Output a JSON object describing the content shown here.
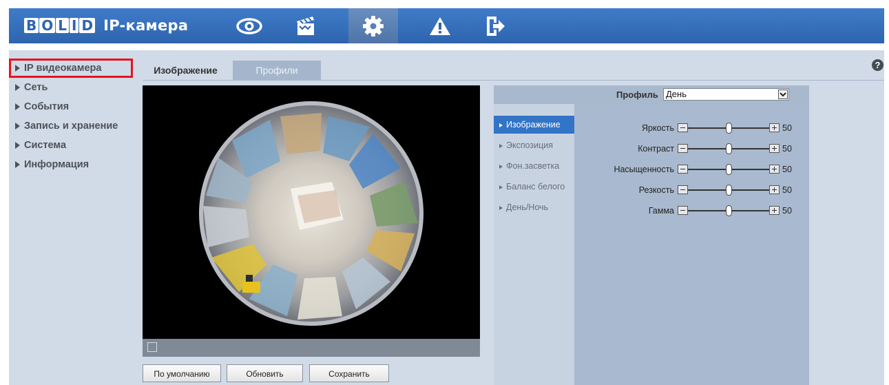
{
  "header": {
    "logo_letters": [
      "B",
      "O",
      "L",
      "I",
      "D"
    ],
    "logo_brand": "BOLID",
    "title": "IP-камера",
    "nav": [
      {
        "icon": "eye-icon"
      },
      {
        "icon": "clapperboard-icon"
      },
      {
        "icon": "gear-icon",
        "active": true
      },
      {
        "icon": "warning-icon"
      },
      {
        "icon": "exit-icon"
      }
    ]
  },
  "sidebar": {
    "items": [
      {
        "label": "IP видеокамера",
        "selected": true
      },
      {
        "label": "Сеть"
      },
      {
        "label": "События"
      },
      {
        "label": "Запись и хранение"
      },
      {
        "label": "Система"
      },
      {
        "label": "Информация"
      }
    ]
  },
  "tabs": [
    {
      "label": "Изображение",
      "active": true
    },
    {
      "label": "Профили",
      "active": false
    }
  ],
  "help_label": "?",
  "profile": {
    "label": "Профиль",
    "value": "День"
  },
  "subnav": [
    {
      "label": "Изображение",
      "active": true
    },
    {
      "label": "Экспозиция"
    },
    {
      "label": "Фон.засветка"
    },
    {
      "label": "Баланс белого"
    },
    {
      "label": "День/Ночь"
    }
  ],
  "sliders": [
    {
      "label": "Яркость",
      "value": "50",
      "fraction": 0.5
    },
    {
      "label": "Контраст",
      "value": "50",
      "fraction": 0.5
    },
    {
      "label": "Насыщенность",
      "value": "50",
      "fraction": 0.5
    },
    {
      "label": "Резкость",
      "value": "50",
      "fraction": 0.5
    },
    {
      "label": "Гамма",
      "value": "50",
      "fraction": 0.5
    }
  ],
  "buttons": {
    "default": "По умолчанию",
    "refresh": "Обновить",
    "save": "Сохранить"
  },
  "colors": {
    "header": "#3a72bd",
    "panel": "#d1dae7",
    "accent": "#3274c6",
    "highlight_border": "#e8121c"
  }
}
